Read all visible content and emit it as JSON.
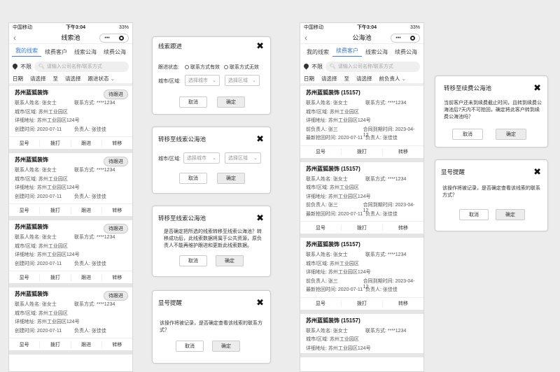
{
  "phone1": {
    "status": {
      "carrier": "中国移动",
      "time": "下午3:04",
      "battery": "33%"
    },
    "title": "线索池",
    "tabs": [
      "我的线索",
      "续费客户",
      "线索公海",
      "续费公海"
    ],
    "active_tab": 0,
    "location": "不限",
    "search_placeholder": "请输入公司名称/联系方式",
    "filter": {
      "date": "日期",
      "start": "请选择",
      "to": "至",
      "end": "请选择",
      "status": "跟进状态"
    },
    "cards": [
      {
        "name": "苏州蓝狐装饰",
        "badge": "待跟进",
        "contact": "联系人姓名: 张女士",
        "phone": "联系方式: ****1234",
        "city": "城市/区域: 苏州工业园区",
        "addr": "详细地址: 苏州工业园区124号",
        "created": "创建时间: 2020-07-11",
        "owner": "负责人: 张佳佳",
        "actions": [
          "显号",
          "拨打",
          "跟进",
          "转移"
        ]
      },
      {
        "name": "苏州蓝狐装饰",
        "badge": "待跟进",
        "contact": "联系人姓名: 张女士",
        "phone": "联系方式: ****1234",
        "city": "城市/区域: 苏州工业园区",
        "addr": "详细地址: 苏州工业园区124号",
        "created": "创建时间: 2020-07-11",
        "owner": "负责人: 张佳佳",
        "actions": [
          "显号",
          "拨打",
          "跟进",
          "转移"
        ]
      },
      {
        "name": "苏州蓝狐装饰",
        "badge": "待跟进",
        "contact": "联系人姓名: 张女士",
        "phone": "联系方式: ****1234",
        "city": "城市/区域: 苏州工业园区",
        "addr": "详细地址: 苏州工业园区124号",
        "created": "创建时间: 2020-07-11",
        "owner": "负责人: 张佳佳",
        "actions": [
          "显号",
          "拨打",
          "跟进",
          "转移"
        ]
      },
      {
        "name": "苏州蓝狐装饰",
        "badge": "待跟进",
        "contact": "联系人姓名: 张女士",
        "phone": "联系方式: ****1234",
        "city": "城市/区域: 苏州工业园区",
        "addr": "详细地址: 苏州工业园区124号",
        "created": "创建时间: 2020-07-11",
        "owner": "负责人: 张佳佳",
        "actions": [
          "显号",
          "拨打",
          "跟进",
          "转移"
        ]
      }
    ]
  },
  "phone2": {
    "status": {
      "carrier": "中国移动",
      "time": "下午3:04",
      "battery": "33%"
    },
    "title": "公海池",
    "tabs": [
      "我的线索",
      "续费客户",
      "线索公海",
      "续费公海"
    ],
    "active_tab": 1,
    "location": "不限",
    "search_placeholder": "请输入公司名称/联系方式",
    "filter": {
      "date": "日期",
      "start": "请选择",
      "to": "至",
      "end": "请选择",
      "status": "前负责人"
    },
    "cards": [
      {
        "name": "苏州蓝狐装饰 (15157)",
        "contact": "联系人姓名: 张女士",
        "phone": "联系方式: ****1234",
        "city": "城市/区域: 苏州工业园区",
        "addr": "详细地址: 苏州工业园区124号",
        "prev": "前负责人: 张三",
        "expire": "合同到期时间: 2023-04-12",
        "latest": "最新抢回时间: 2020-07-11",
        "owner": "负责人: 张佳佳",
        "actions": [
          "显号",
          "拨打",
          "转移"
        ]
      },
      {
        "name": "苏州蓝狐装饰 (15157)",
        "contact": "联系人姓名: 张女士",
        "phone": "联系方式: ****1234",
        "city": "城市/区域: 苏州工业园区",
        "addr": "详细地址: 苏州工业园区124号",
        "prev": "前负责人: 张三",
        "expire": "合同到期时间: 2023-04-12",
        "latest": "最新抢回时间: 2020-07-11",
        "owner": "负责人: 张佳佳",
        "actions": [
          "显号",
          "拨打",
          "转移"
        ]
      },
      {
        "name": "苏州蓝狐装饰 (15157)",
        "contact": "联系人姓名: 张女士",
        "phone": "联系方式: ****1234",
        "city": "城市/区域: 苏州工业园区",
        "addr": "详细地址: 苏州工业园区124号",
        "prev": "前负责人: 张三",
        "expire": "合同到期时间: 2023-04-12",
        "latest": "最新抢回时间: 2020-07-11",
        "owner": "负责人: 张佳佳",
        "actions": [
          "显号",
          "拨打",
          "转移"
        ]
      },
      {
        "name": "苏州蓝狐装饰 (15157)",
        "contact": "联系人姓名: 张女士",
        "phone": "联系方式: ****1234",
        "city": "城市/区域: 苏州工业园区",
        "addr": "详细地址: 苏州工业园区124号"
      }
    ]
  },
  "dlg_follow": {
    "title": "线索跟进",
    "status_label": "跟进状态:",
    "opt1": "联系方式有效",
    "opt2": "联系方式无效",
    "city_label": "城市/区域:",
    "city_ph": "选择城市",
    "area_ph": "选择区域",
    "cancel": "取消",
    "ok": "确定"
  },
  "dlg_move1": {
    "title": "转移至线索公海池",
    "city_label": "城市/区域:",
    "city_ph": "选择城市",
    "area_ph": "选择区域",
    "cancel": "取消",
    "ok": "确定"
  },
  "dlg_move2": {
    "title": "转移至线索公海池",
    "message": "是否确定把所选的线索转移至线索公海池？转移成功后，此线索数据将属于公共资源，原负责人不能再维护跟进和更新此线索数据。",
    "cancel": "取消",
    "ok": "确定"
  },
  "dlg_show1": {
    "title": "显号提醒",
    "message": "该操作将被记录，是否确定查看该线索的联系方式？",
    "cancel": "取消",
    "ok": "确定"
  },
  "dlg_renew": {
    "title": "转移至续费公海池",
    "message": "当前客户还未到续费截止时间，且转到续费公海池后7天内不可抢回，确定将此客户转到续费公海池吗？",
    "cancel": "取消",
    "ok": "确定"
  },
  "dlg_show2": {
    "title": "显号提醒",
    "message": "该操作将被记录，是否确定查看该线索的联系方式？",
    "cancel": "取消",
    "ok": "确定"
  }
}
